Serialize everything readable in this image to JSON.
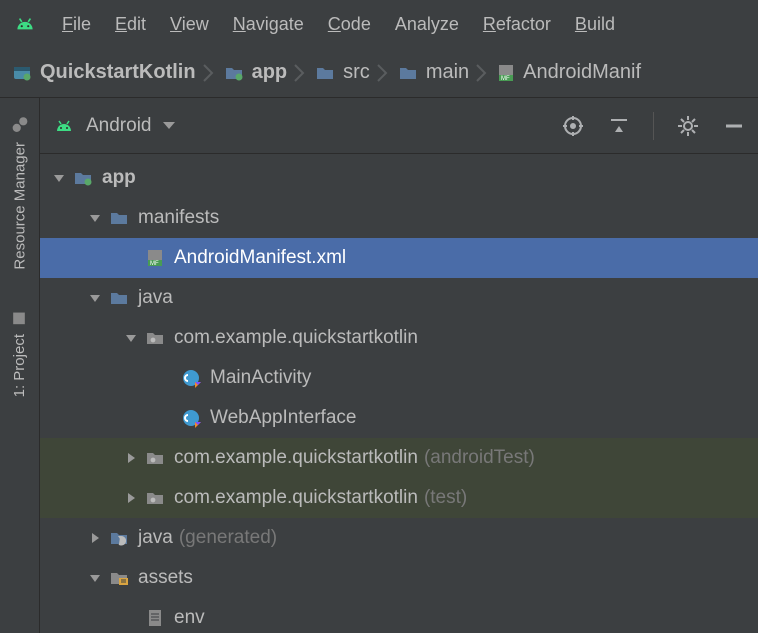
{
  "menu": {
    "items": [
      {
        "label": "File",
        "u": "F",
        "rest": "ile"
      },
      {
        "label": "Edit",
        "u": "E",
        "rest": "dit"
      },
      {
        "label": "View",
        "u": "V",
        "rest": "iew"
      },
      {
        "label": "Navigate",
        "u": "N",
        "rest": "avigate"
      },
      {
        "label": "Code",
        "u": "C",
        "rest": "ode"
      },
      {
        "label": "Analyze",
        "u": null,
        "rest": "Analyze"
      },
      {
        "label": "Refactor",
        "u": "R",
        "rest": "efactor"
      },
      {
        "label": "Build",
        "u": "B",
        "rest": "uild"
      }
    ]
  },
  "breadcrumb": {
    "items": [
      {
        "label": "QuickstartKotlin",
        "icon": "project-icon",
        "bold": true
      },
      {
        "label": "app",
        "icon": "module-icon",
        "bold": true
      },
      {
        "label": "src",
        "icon": "folder-icon",
        "bold": false
      },
      {
        "label": "main",
        "icon": "folder-icon",
        "bold": false
      },
      {
        "label": "AndroidManif",
        "icon": "manifest-icon",
        "bold": false
      }
    ]
  },
  "side_tabs": {
    "items": [
      {
        "label": "Resource Manager",
        "icon": "resource-icon"
      },
      {
        "label": "1: Project",
        "icon": "project-tab-icon"
      }
    ]
  },
  "panel": {
    "dropdown_label": "Android",
    "mode_icon": "android-icon",
    "toolbar": {
      "target": "target-icon",
      "collapse": "collapse-icon",
      "settings": "gear-icon",
      "hide": "minimize-icon"
    }
  },
  "tree": {
    "rows": [
      {
        "depth": 0,
        "arrow": "down",
        "icon": "module-icon",
        "label": "app",
        "bold": true,
        "selected": false,
        "shade": false,
        "suffix": ""
      },
      {
        "depth": 1,
        "arrow": "down",
        "icon": "folder-icon",
        "label": "manifests",
        "bold": false,
        "selected": false,
        "shade": false,
        "suffix": ""
      },
      {
        "depth": 2,
        "arrow": "",
        "icon": "manifest-icon",
        "label": "AndroidManifest.xml",
        "bold": false,
        "selected": true,
        "shade": false,
        "suffix": ""
      },
      {
        "depth": 1,
        "arrow": "down",
        "icon": "folder-icon",
        "label": "java",
        "bold": false,
        "selected": false,
        "shade": false,
        "suffix": ""
      },
      {
        "depth": 2,
        "arrow": "down",
        "icon": "package-icon",
        "label": "com.example.quickstartkotlin",
        "bold": false,
        "selected": false,
        "shade": false,
        "suffix": ""
      },
      {
        "depth": 3,
        "arrow": "",
        "icon": "kotlin-class-icon",
        "label": "MainActivity",
        "bold": false,
        "selected": false,
        "shade": false,
        "suffix": ""
      },
      {
        "depth": 3,
        "arrow": "",
        "icon": "kotlin-class-icon",
        "label": "WebAppInterface",
        "bold": false,
        "selected": false,
        "shade": false,
        "suffix": ""
      },
      {
        "depth": 2,
        "arrow": "right",
        "icon": "package-icon",
        "label": "com.example.quickstartkotlin",
        "bold": false,
        "selected": false,
        "shade": true,
        "suffix": "(androidTest)"
      },
      {
        "depth": 2,
        "arrow": "right",
        "icon": "package-icon",
        "label": "com.example.quickstartkotlin",
        "bold": false,
        "selected": false,
        "shade": true,
        "suffix": "(test)"
      },
      {
        "depth": 1,
        "arrow": "right",
        "icon": "gen-folder-icon",
        "label": "java",
        "bold": false,
        "selected": false,
        "shade": false,
        "suffix": "(generated)"
      },
      {
        "depth": 1,
        "arrow": "down",
        "icon": "assets-folder-icon",
        "label": "assets",
        "bold": false,
        "selected": false,
        "shade": false,
        "suffix": ""
      },
      {
        "depth": 2,
        "arrow": "",
        "icon": "file-icon",
        "label": "env",
        "bold": false,
        "selected": false,
        "shade": false,
        "suffix": ""
      }
    ]
  }
}
